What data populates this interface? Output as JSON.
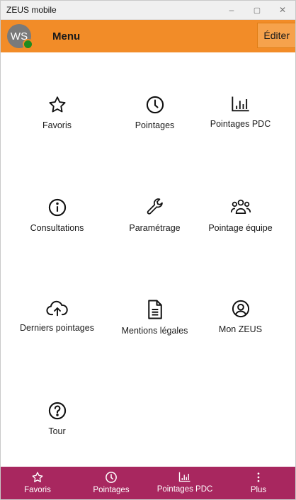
{
  "window": {
    "title": "ZEUS mobile",
    "minimize": "–",
    "maximize": "▢",
    "close": "✕"
  },
  "header": {
    "avatar_initials": "WS",
    "title": "Menu",
    "edit_label": "Éditer"
  },
  "menu": [
    {
      "label": "Favoris",
      "icon": "star-icon"
    },
    {
      "label": "Pointages",
      "icon": "clock-icon"
    },
    {
      "label": "Pointages PDC",
      "icon": "bar-chart-icon"
    },
    {
      "label": "Consultations",
      "icon": "info-icon"
    },
    {
      "label": "Paramétrage",
      "icon": "wrench-icon"
    },
    {
      "label": "Pointage équipe",
      "icon": "team-icon"
    },
    {
      "label": "Derniers pointages",
      "icon": "cloud-upload-icon"
    },
    {
      "label": "Mentions légales",
      "icon": "document-icon"
    },
    {
      "label": "Mon ZEUS",
      "icon": "user-circle-icon"
    },
    {
      "label": "Tour",
      "icon": "help-icon"
    }
  ],
  "tabbar": [
    {
      "label": "Favoris",
      "icon": "star-icon"
    },
    {
      "label": "Pointages",
      "icon": "clock-icon"
    },
    {
      "label": "Pointages PDC",
      "icon": "bar-chart-icon"
    },
    {
      "label": "Plus",
      "icon": "more-vertical-icon"
    }
  ],
  "colors": {
    "header": "#f28c28",
    "tabbar": "#a8275f",
    "presence": "#1e8b20",
    "avatar": "#7a7a7a"
  }
}
